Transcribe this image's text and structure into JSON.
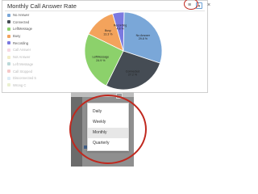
{
  "widget": {
    "title": "Monthly Call Answer Rate",
    "icons": {
      "menu": "hamburger-icon",
      "filter": "filter-icon",
      "close": "close-icon"
    },
    "close_glyph": "×",
    "menu_glyph": "≡"
  },
  "legend": [
    {
      "label": "No Answer",
      "color": "#7aa7d8",
      "active": true
    },
    {
      "label": "Connected",
      "color": "#454c54",
      "active": true
    },
    {
      "label": "LeftMessage",
      "color": "#8cd16b",
      "active": true
    },
    {
      "label": "Busy",
      "color": "#f3a35c",
      "active": true
    },
    {
      "label": "Recording",
      "color": "#7b79e0",
      "active": true
    },
    {
      "label": "Call Answer",
      "color": "#e88da8",
      "active": false
    },
    {
      "label": "Not Answer",
      "color": "#d9cc5a",
      "active": false
    },
    {
      "label": "Left Message",
      "color": "#3d8e8e",
      "active": false
    },
    {
      "label": "Call Stopped",
      "color": "#e26060",
      "active": false
    },
    {
      "label": "Disconnected 5",
      "color": "#9ac9e6",
      "active": false
    },
    {
      "label": "Wrong C",
      "color": "#c4d37a",
      "active": false
    }
  ],
  "chart_data": {
    "type": "pie",
    "slices": [
      {
        "name": "No Answer",
        "value": 29.8,
        "label": "No Answer\n29.8 %",
        "color": "#7aa7d8"
      },
      {
        "name": "Connected",
        "value": 27.2,
        "label": "Connected\n27.2 %",
        "color": "#454c54"
      },
      {
        "name": "LeftMessage",
        "value": 24.9,
        "label": "LeftMessage\n24.9 %",
        "color": "#8cd16b"
      },
      {
        "name": "Busy",
        "value": 13.3,
        "label": "Busy\n13.3 %",
        "color": "#f3a35c"
      },
      {
        "name": "Recording",
        "value": 4.8,
        "label": "Recording\n4.8 %",
        "color": "#7b79e0"
      }
    ]
  },
  "dropdown": {
    "items": [
      {
        "label": "Daily",
        "selected": false
      },
      {
        "label": "Weekly",
        "selected": false
      },
      {
        "label": "Monthly",
        "selected": true
      },
      {
        "label": "Quarterly",
        "selected": false
      }
    ]
  }
}
